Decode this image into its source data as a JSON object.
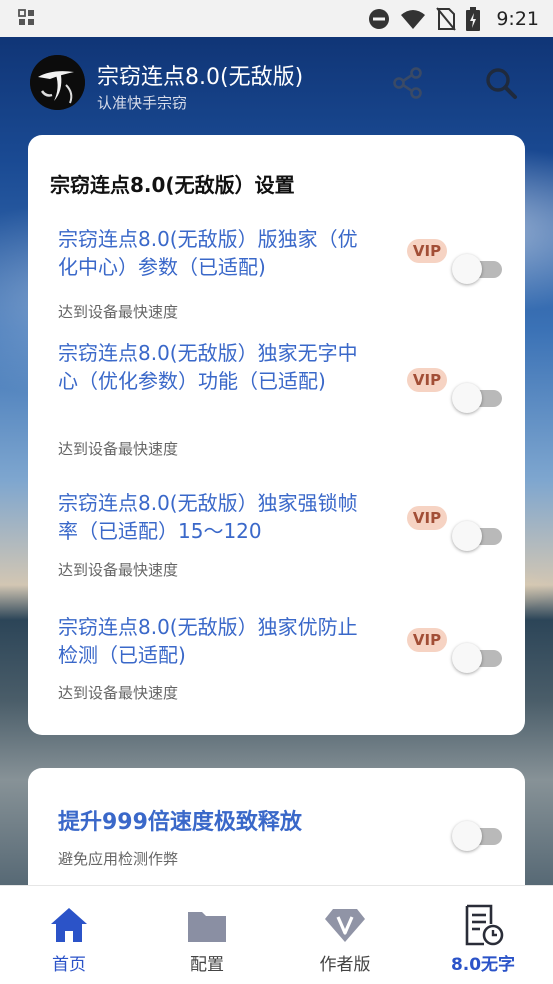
{
  "status_bar": {
    "time": "9:21"
  },
  "header": {
    "app_title": "宗窃连点8.0(无敌版)",
    "subtitle": "认准快手宗窃"
  },
  "settings_card": {
    "title": "宗窃连点8.0(无敌版）设置",
    "items": [
      {
        "title": "宗窃连点8.0(无敌版）版独家（优化中心）参数（已适配)",
        "subtitle": "达到设备最快速度",
        "badge": "VIP",
        "enabled": false
      },
      {
        "title": "宗窃连点8.0(无敌版）独家无字中心（优化参数）功能（已适配)",
        "subtitle": "达到设备最快速度",
        "badge": "VIP",
        "enabled": false
      },
      {
        "title": "宗窃连点8.0(无敌版）独家强锁帧率（已适配）15～120",
        "subtitle": "达到设备最快速度",
        "badge": "VIP",
        "enabled": false
      },
      {
        "title": "宗窃连点8.0(无敌版）独家优防止检测（已适配)",
        "subtitle": "达到设备最快速度",
        "badge": "VIP",
        "enabled": false
      }
    ]
  },
  "boost_card": {
    "title": "提升999倍速度极致释放",
    "subtitle": "避免应用检测作弊",
    "enabled": false
  },
  "bottom_nav": {
    "items": [
      {
        "label": "首页",
        "icon": "home-icon"
      },
      {
        "label": "配置",
        "icon": "folder-icon"
      },
      {
        "label": "作者版",
        "icon": "diamond-v-icon"
      },
      {
        "label": "8.0无字",
        "icon": "document-clock-icon"
      }
    ],
    "active_index": 0
  },
  "colors": {
    "accent": "#3a68c9",
    "nav_active": "#2b53c8",
    "vip_bg": "#f6d3c3",
    "vip_text": "#a24e36",
    "status_bar_bg": "#f2f2f2"
  }
}
